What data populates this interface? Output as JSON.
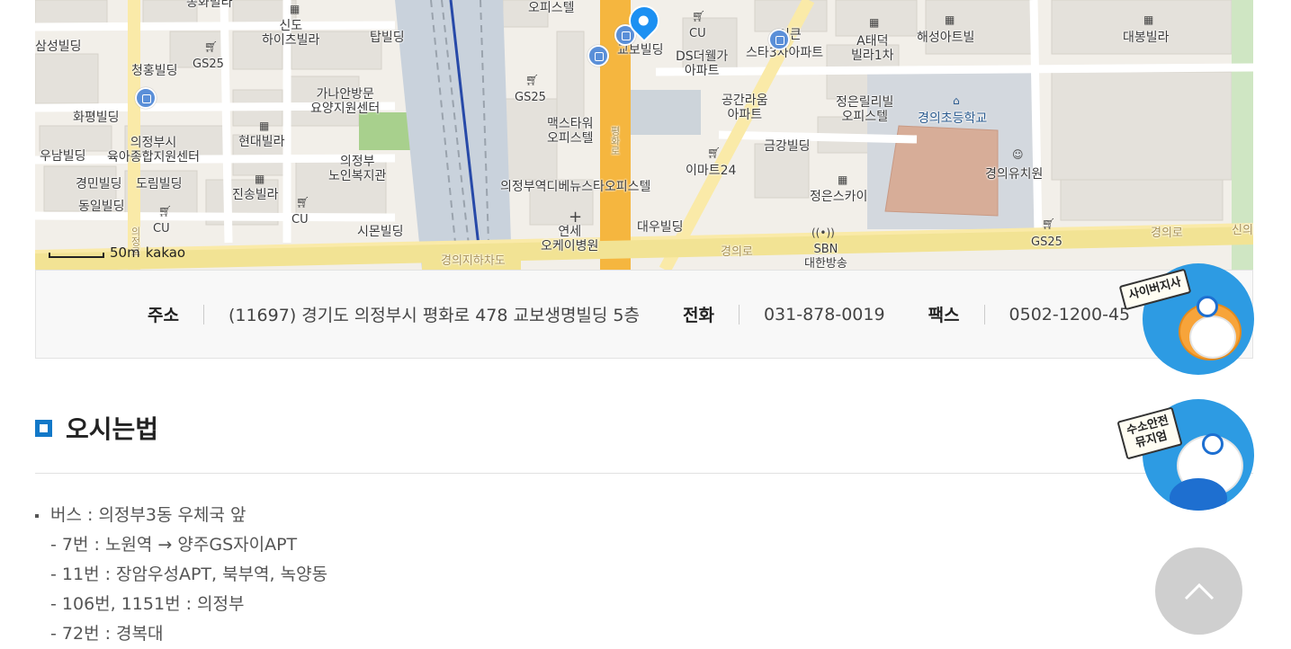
{
  "map": {
    "labels": {
      "samsung": "삼성빌딩",
      "cheonghong": "청홍빌딩",
      "hwapyeong": "화평빌딩",
      "unam": "우남빌딩",
      "childcare": "의정부시\n육아종합지원센터",
      "gyeongmin": "경민빌딩",
      "dorim": "도림빌딩",
      "dongil": "동일빌딩",
      "hyundai": "현대빌라",
      "jinsong": "진송빌라",
      "sindo": "신도\n하이츠빌라",
      "tap": "탑빌딩",
      "ganaan": "가나안방문\n요양지원센터",
      "senior": "의정부\n노인복지관",
      "simon": "시몬빌딩",
      "officetel_top": "오피스텔",
      "maxtower": "맥스타워\n오피스텔",
      "debeneus": "의정부역디베뉴스타오피스텔",
      "yonsei": "연세\n오케이병원",
      "kyobo": "교보빌딩",
      "ds": "DS더웰가\n아파트",
      "starcity": "스타3차아파트",
      "gonggan": "공간라움\n아파트",
      "emart": "이마트24",
      "daewoo": "대우빌딩",
      "geumgang": "금강빌딩",
      "atae": "A태덕\n빌라1차",
      "haeseong": "해성아트빌",
      "jeongeun": "정은릴리빌\n오피스텔",
      "school": "경의초등학교",
      "kindergarten": "경의유치원",
      "jeongeunsky": "정은스카이",
      "daebong": "대봉빌라",
      "sbn": "SBN\n대한방송",
      "gs25_a": "GS25",
      "gs25_b": "GS25",
      "gs25_c": "GS25",
      "cu_a": "CU",
      "cu_b": "CU",
      "cu_c": "CU",
      "road_gyeongui_1": "경의로",
      "road_gyeongui_2": "경의로",
      "road_sin": "신의",
      "underpass": "경의지하차도",
      "pyeonghwa": "평화로",
      "uijeong_road": "의정로",
      "songhwa": "송화빌라",
      "hidden_cut": "이큰"
    },
    "scale_text": "50m",
    "logo_text": "kakao"
  },
  "info": {
    "address_label": "주소",
    "address_value": "(11697) 경기도 의정부시 평화로 478 교보생명빌딩 5층",
    "phone_label": "전화",
    "phone_value": "031-878-0019",
    "fax_label": "팩스",
    "fax_value": "0502-1200-45"
  },
  "section": {
    "title": "오시는법",
    "directions": {
      "head": "버스 : 의정부3동 우체국 앞",
      "routes": [
        "- 7번 : 노원역 → 양주GS자이APT",
        "- 11번 : 장암우성APT, 북부역, 녹양동",
        "- 106번, 1151번 : 의정부",
        "- 72번 : 경복대"
      ]
    }
  },
  "floating": {
    "cyber_branch": "사이버지사",
    "hydrogen_museum": "수소안전\n뮤지엄"
  },
  "colors": {
    "accent": "#1278c8",
    "map_road_major": "#f5b63f",
    "map_road_minor": "#faeaa8",
    "map_background": "#f2efe9",
    "top_button": "#cfcfcf"
  }
}
